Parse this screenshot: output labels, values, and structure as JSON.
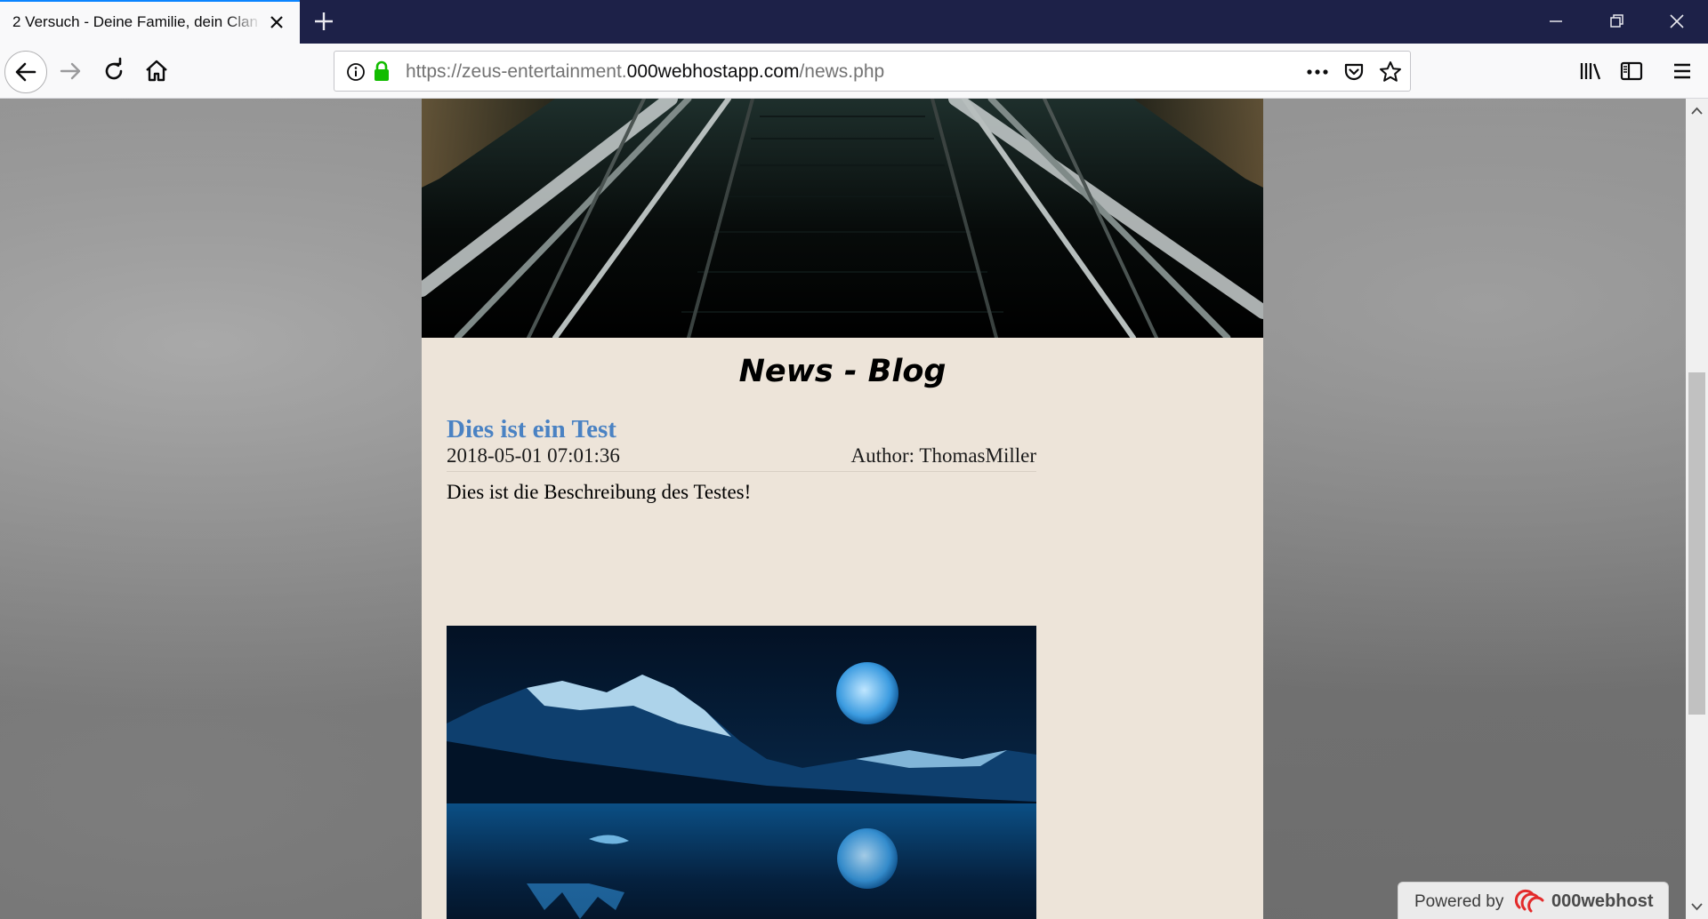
{
  "browser": {
    "tab_title": "2 Versuch - Deine Familie, dein Clan",
    "url_prefix": "https://zeus-entertainment.",
    "url_domain": "000webhostapp.com",
    "url_path": "/news.php",
    "accent_color": "#0a84ff"
  },
  "page": {
    "heading": "News - Blog",
    "posts": [
      {
        "title": "Dies ist ein Test",
        "date": "2018-05-01 07:01:36",
        "author": "Author: ThomasMiller",
        "description": "Dies ist die Beschreibung des Testes!"
      }
    ],
    "title_color": "#4a82c3"
  },
  "badge": {
    "label": "Powered by",
    "brand": "000webhost"
  },
  "icons": {
    "tab_close": "close-icon",
    "new_tab": "plus-icon",
    "minimize": "minimize-icon",
    "restore": "restore-icon",
    "close_window": "close-icon",
    "back": "arrow-left-icon",
    "forward": "arrow-right-icon",
    "reload": "reload-icon",
    "home": "home-icon",
    "info": "info-icon",
    "lock": "lock-icon",
    "page_actions": "more-icon",
    "pocket": "pocket-icon",
    "bookmark": "star-icon",
    "library": "library-icon",
    "sidebar": "sidebar-icon",
    "menu": "hamburger-menu-icon"
  }
}
